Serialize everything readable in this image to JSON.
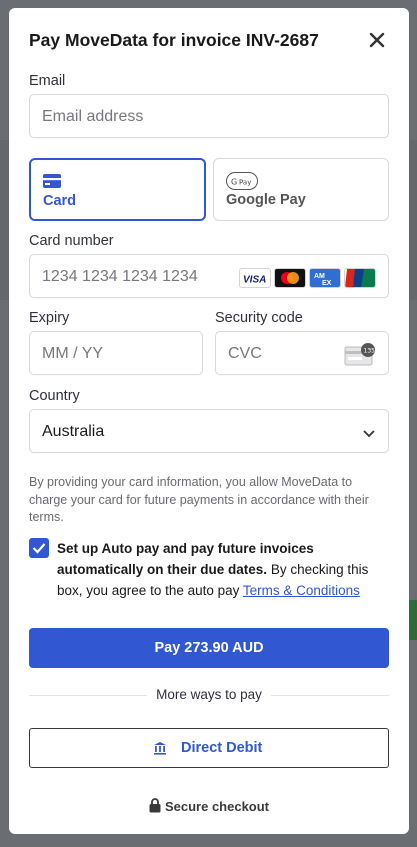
{
  "modal": {
    "title": "Pay MoveData for invoice INV-2687",
    "close_icon": "close-icon"
  },
  "email": {
    "label": "Email",
    "placeholder": "Email address"
  },
  "payment_methods": [
    {
      "label": "Card",
      "icon": "card-icon",
      "active": true
    },
    {
      "label": "Google Pay",
      "icon": "google-pay-icon",
      "active": false
    }
  ],
  "card_number": {
    "label": "Card number",
    "placeholder": "1234 1234 1234 1234",
    "brands": [
      "visa-icon",
      "mastercard-icon",
      "amex-icon",
      "unionpay-icon"
    ]
  },
  "expiry": {
    "label": "Expiry",
    "placeholder": "MM / YY"
  },
  "security_code": {
    "label": "Security code",
    "placeholder": "CVC",
    "icon": "cvc-card-icon"
  },
  "country": {
    "label": "Country",
    "value": "Australia"
  },
  "notice": "By providing your card information, you allow MoveData to charge your card for future payments in accordance with their terms.",
  "autopay": {
    "checked": true,
    "bold_text": "Set up Auto pay and pay future invoices automatically on their due dates.",
    "text": " By checking this box, you agree to the auto pay ",
    "link": "Terms & Conditions"
  },
  "pay_button": "Pay 273.90 AUD",
  "more_ways": "More ways to pay",
  "direct_debit": "Direct Debit",
  "secure_checkout": "Secure checkout",
  "colors": {
    "accent": "#3157d3",
    "overlay": "#5c5f63"
  }
}
